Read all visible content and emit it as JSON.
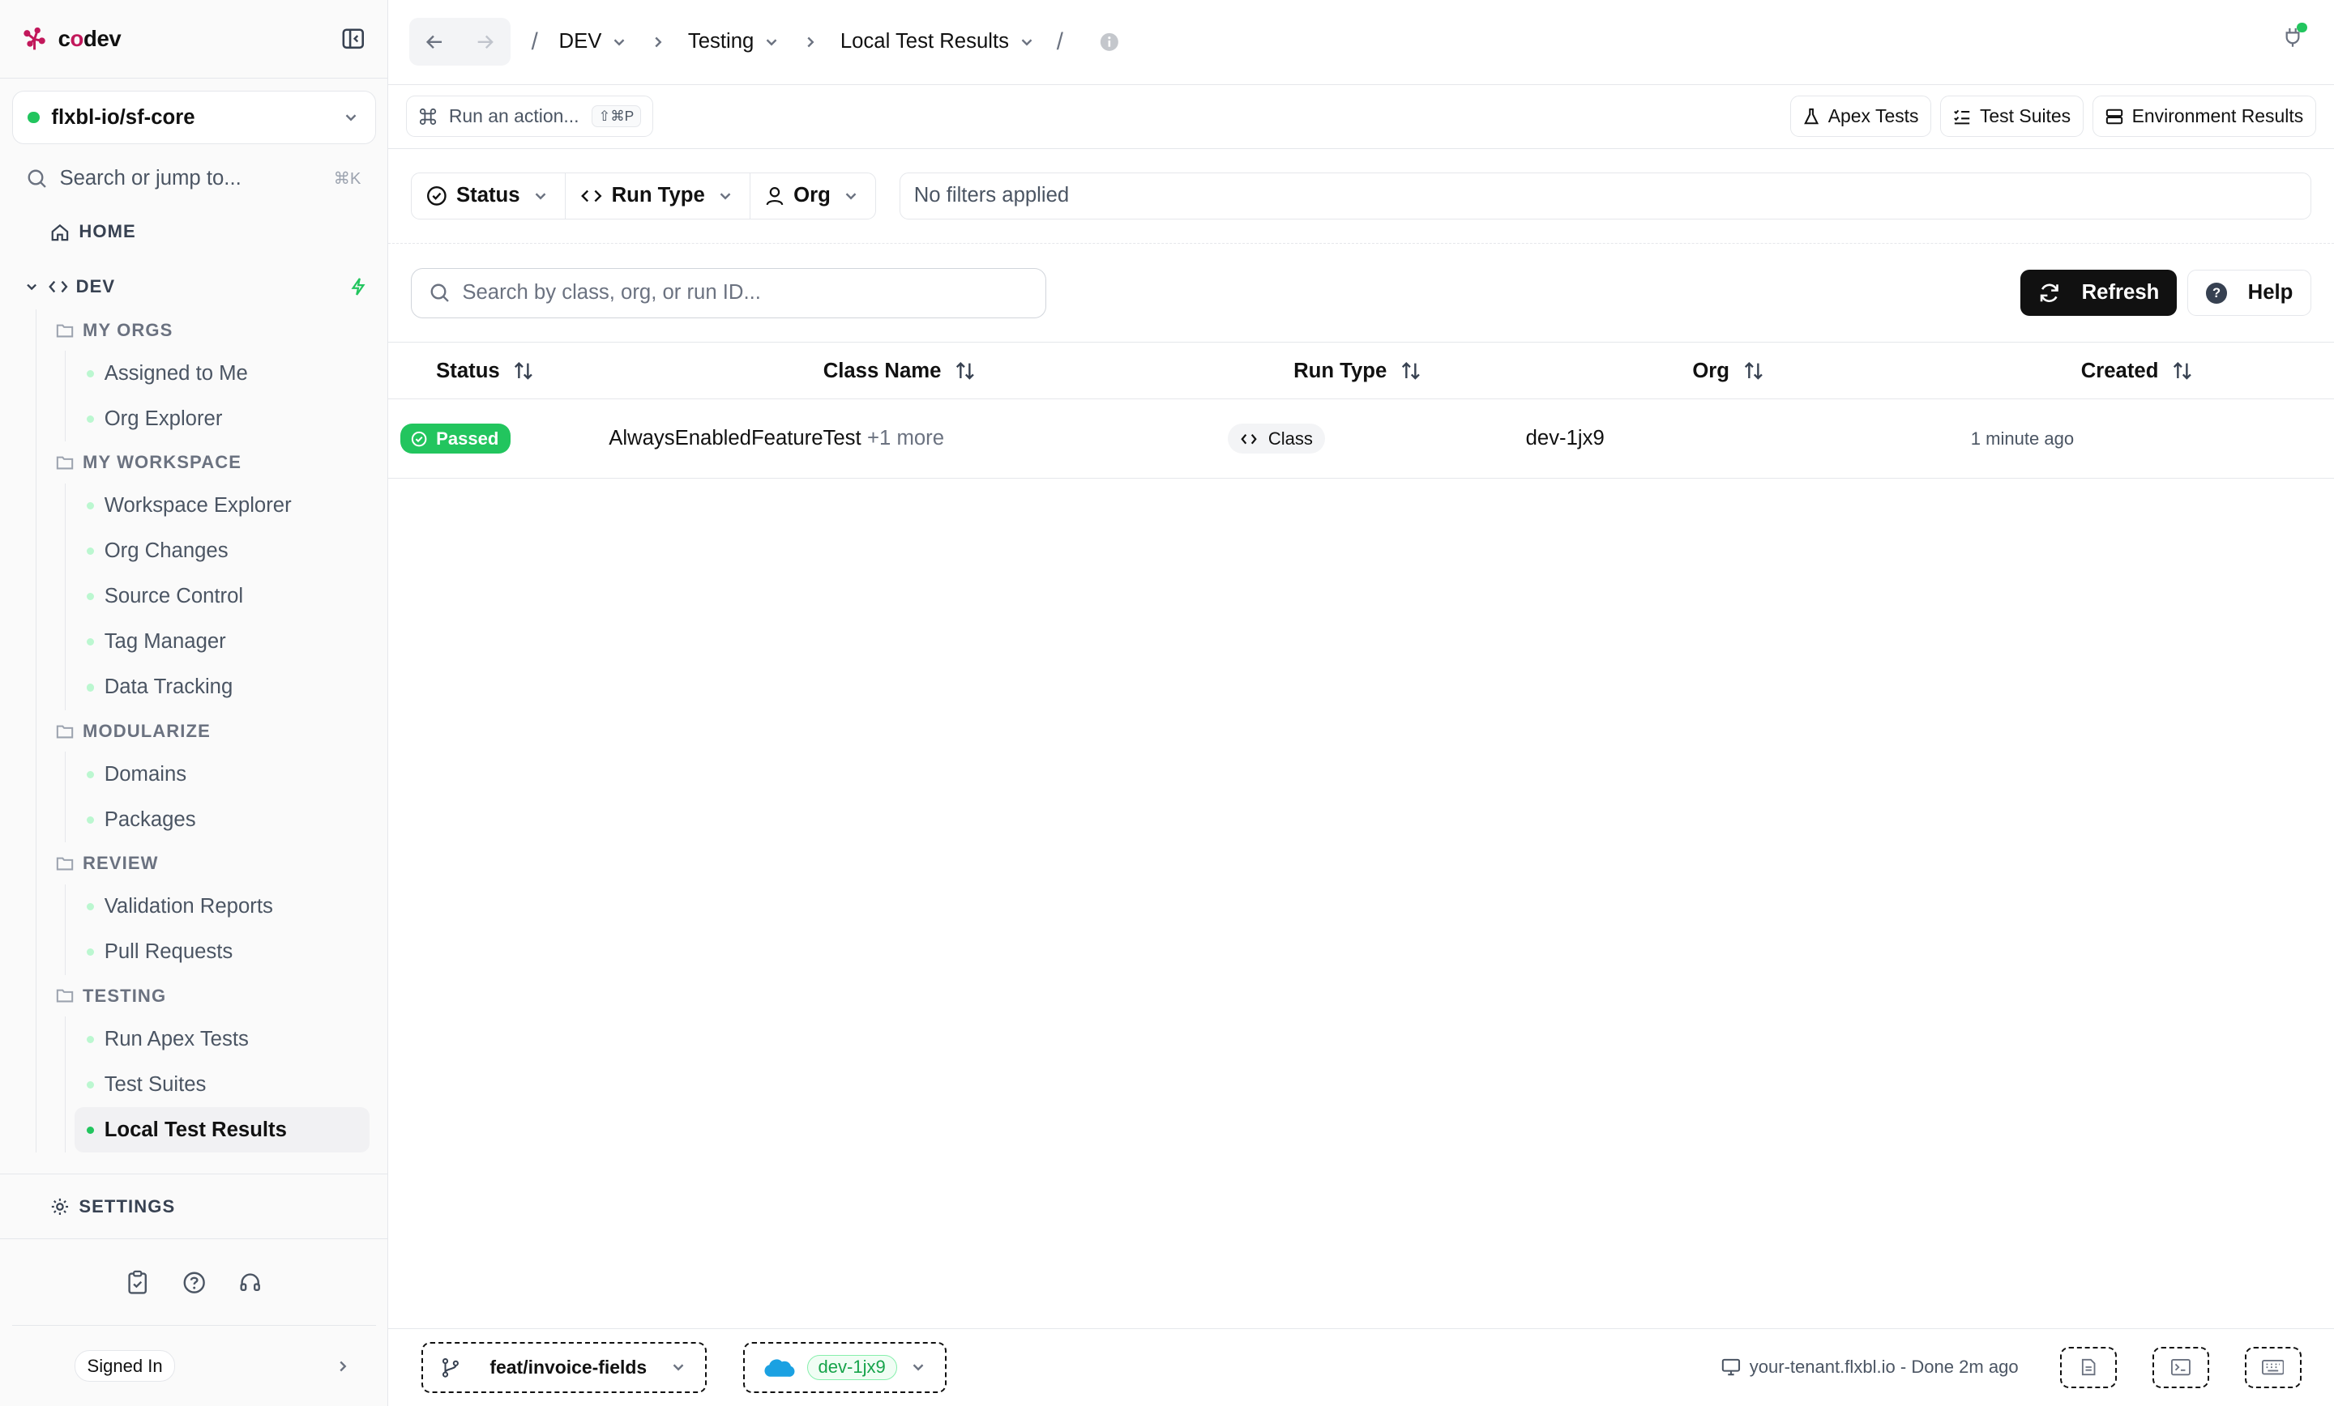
{
  "app": {
    "logo_prefix": "c",
    "logo_mid": "o",
    "logo_suffix": "dev"
  },
  "sidebar": {
    "repo": "flxbl-io/sf-core",
    "search_placeholder": "Search or jump to...",
    "search_shortcut": "⌘K",
    "home": "HOME",
    "dev": "DEV",
    "groups": [
      {
        "title": "MY ORGS",
        "items": [
          "Assigned to Me",
          "Org Explorer"
        ]
      },
      {
        "title": "MY WORKSPACE",
        "items": [
          "Workspace Explorer",
          "Org Changes",
          "Source Control",
          "Tag Manager",
          "Data Tracking"
        ]
      },
      {
        "title": "MODULARIZE",
        "items": [
          "Domains",
          "Packages"
        ]
      },
      {
        "title": "REVIEW",
        "items": [
          "Validation Reports",
          "Pull Requests"
        ]
      },
      {
        "title": "TESTING",
        "items": [
          "Run Apex Tests",
          "Test Suites",
          "Local Test Results"
        ]
      }
    ],
    "settings": "SETTINGS",
    "signed_in": "Signed In"
  },
  "topbar": {
    "crumbs": [
      "DEV",
      "Testing",
      "Local Test Results"
    ]
  },
  "actionbar": {
    "run_action": "Run an action...",
    "run_action_kbd": "⇧⌘P",
    "tabs": [
      "Apex Tests",
      "Test Suites",
      "Environment Results"
    ]
  },
  "filters": {
    "buttons": [
      "Status",
      "Run Type",
      "Org"
    ],
    "summary": "No filters applied"
  },
  "search": {
    "placeholder": "Search by class, org, or run ID...",
    "refresh": "Refresh",
    "help": "Help"
  },
  "table": {
    "columns": [
      "Status",
      "Class Name",
      "Run Type",
      "Org",
      "Created"
    ],
    "rows": [
      {
        "status": "Passed",
        "class_name": "AlwaysEnabledFeatureTest",
        "more": "+1 more",
        "run_type": "Class",
        "org": "dev-1jx9",
        "created": "1 minute ago"
      }
    ]
  },
  "statusbar": {
    "branch": "feat/invoice-fields",
    "org": "dev-1jx9",
    "tenant": "your-tenant.flxbl.io - Done 2m ago"
  }
}
